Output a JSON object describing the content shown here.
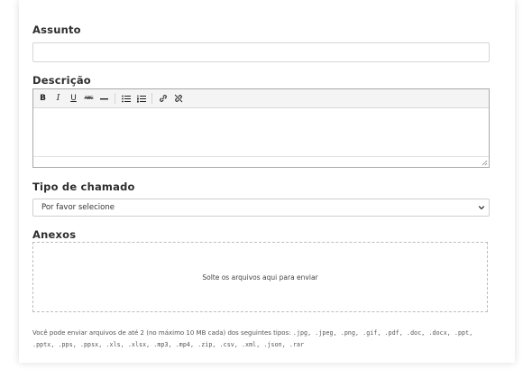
{
  "form": {
    "subject": {
      "label": "Assunto",
      "value": "",
      "placeholder": ""
    },
    "description": {
      "label": "Descrição",
      "toolbar": {
        "bold": "B",
        "italic": "I",
        "underline": "U",
        "strikethrough": "ABC"
      }
    },
    "ticket_type": {
      "label": "Tipo de chamado",
      "selected": "Por favor selecione"
    },
    "attachments": {
      "label": "Anexos",
      "dropzone_text": "Solte os arquivos aqui para enviar",
      "helper_text": "Você pode enviar arquivos de até 2 (no máximo 10 MB cada) dos seguintes tipos:",
      "allowed_types": ".jpg, .jpeg, .png, .gif, .pdf, .doc, .docx, .ppt, .pptx, .pps, .ppsx, .xls, .xlsx, .mp3, .mp4, .zip, .csv, .xml, .json, .rar"
    }
  },
  "colors": {
    "border": "#d6d6d6",
    "editor_border": "#aaaaaa",
    "dashed_border": "#bdbdbd",
    "toolbar_bg": "#f4f4f4"
  }
}
